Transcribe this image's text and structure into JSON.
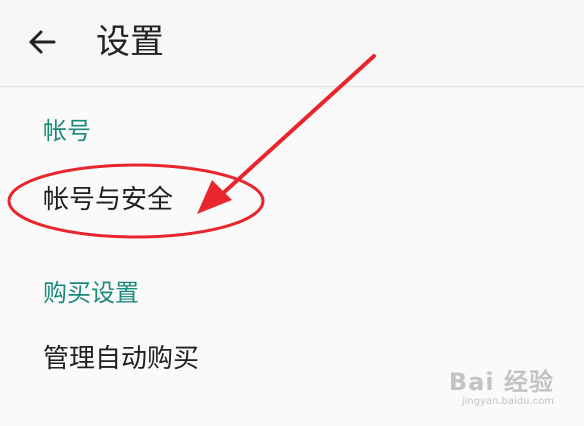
{
  "header": {
    "title": "设置"
  },
  "sections": [
    {
      "header": "帐号",
      "items": [
        {
          "label": "帐号与安全"
        }
      ]
    },
    {
      "header": "购买设置",
      "items": [
        {
          "label": "管理自动购买"
        }
      ]
    }
  ],
  "annotation": {
    "color": "#e8262c"
  },
  "watermark": {
    "main": "Bai 经验",
    "sub": "jingyan.baidu.com"
  },
  "colors": {
    "section_header": "#1a8a7c",
    "item_text": "#202020",
    "background": "#fafafa"
  }
}
